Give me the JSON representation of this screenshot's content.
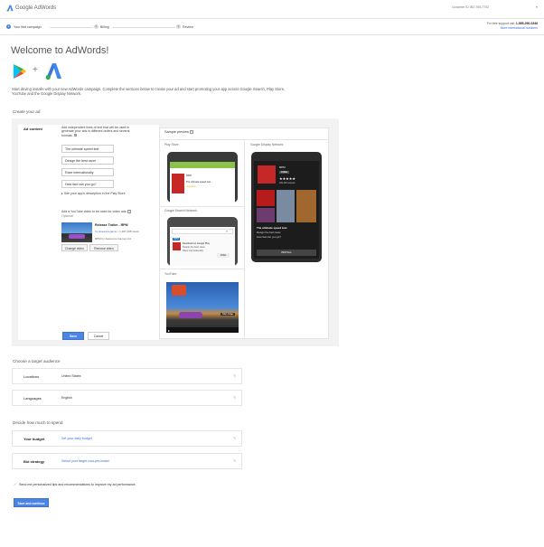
{
  "header": {
    "app_name": "Google AdWords",
    "customer_id": "Customer ID: 867-993-7792",
    "customer_caret": "▾"
  },
  "steps": [
    {
      "num": "1",
      "label": "Your first campaign",
      "active": true
    },
    {
      "num": "2",
      "label": "Billing",
      "active": false
    },
    {
      "num": "3",
      "label": "Review",
      "active": false
    }
  ],
  "support": {
    "label": "For free support call:",
    "phone": "1-855-290-0346",
    "intl_link": "More international numbers"
  },
  "welcome": {
    "title": "Welcome to AdWords!",
    "plus": "+",
    "intro": "Start driving installs with your new AdWords campaign. Complete the sections below to create your ad and start promoting your app across Google Search, Play Store, YouTube and the Google Display Network."
  },
  "create_ad": {
    "section_title": "Create your ad",
    "ad_content_label": "Ad content",
    "text_instructions": "Add independent lines of text that will be used to generate your ads in different orders and several formats.",
    "lines": [
      "The ultimate speed test",
      "Design the best racer",
      "Race internationally",
      "How fast can you go?"
    ],
    "see_description": "See your app's description in the Play Store",
    "video_instructions": "Add a YouTube video to be used for video ads.",
    "optional": "Optional",
    "video_title": "Release Trailer - RPM",
    "video_channel": "by awesomegame",
    "video_views": "1,487,208 views",
    "video_publisher": "RPM by Awesome Games Ltd",
    "change_video": "Change video",
    "remove_video": "Remove video",
    "save": "Save",
    "cancel": "Cancel"
  },
  "preview": {
    "title": "Sample preview",
    "play_store": "Play Store",
    "gdn": "Google Display Network",
    "search": "Google Search Network",
    "youtube": "YouTube",
    "ad_app": "RPM",
    "ad_line": "The ultimate speed test.",
    "ad_line2": "Design the best racer.",
    "ad_line3": "How fast can you go?",
    "install": "INSTALL",
    "free": "FREE",
    "stars": "★★★★★",
    "review_count": "192,440 reviews",
    "search_ad1": "Download on Google Play",
    "search_ad2": "Design the best racer.",
    "search_ad3": "Race internationally.",
    "skip_ad": "Skip Ad ▶|"
  },
  "audience": {
    "section_title": "Choose a target audience",
    "locations_label": "Locations",
    "locations_value": "United States",
    "languages_label": "Languages",
    "languages_value": "English"
  },
  "spend": {
    "section_title": "Decide how much to spend",
    "budget_label": "Your budget",
    "budget_link": "Set your daily budget",
    "bid_label": "Bid strategy",
    "bid_link": "Select your target cost-per-install"
  },
  "tips_checkbox": "Send me personalized tips and recommendations to improve my ad performance.",
  "save_continue": "Save and continue",
  "colors": {
    "accent": "#4a86e8",
    "link": "#3b6fd8"
  }
}
